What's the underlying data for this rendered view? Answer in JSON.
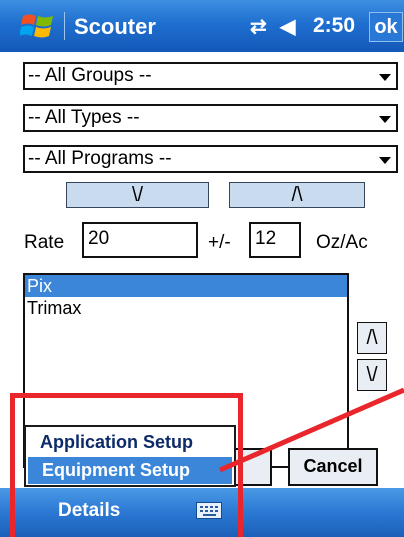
{
  "titlebar": {
    "app_title": "Scouter",
    "time": "2:50",
    "ok_label": "ok",
    "connectivity_icon": "connectivity-icon",
    "volume_icon": "volume-icon",
    "start_icon": "windows-flag-icon"
  },
  "filters": {
    "groups": "-- All Groups --",
    "types": "-- All Types --",
    "programs": "-- All Programs --"
  },
  "sort": {
    "down_label": "\\/",
    "up_label": "/\\"
  },
  "rate": {
    "label": "Rate",
    "value": "20",
    "plusminus_label": "+/-",
    "tolerance": "12",
    "unit": "Oz/Ac"
  },
  "list": {
    "items": [
      "Pix",
      "Trimax"
    ],
    "selected_index": 0
  },
  "side_buttons": {
    "up": "/\\",
    "down": "\\/"
  },
  "buttons": {
    "cancel": "Cancel"
  },
  "menu": {
    "details": "Details",
    "keyboard_icon": "keyboard-icon",
    "popup": [
      "Application Setup",
      "Equipment Setup"
    ],
    "popup_selected_index": 1
  },
  "colors": {
    "titlebar": "#1f6fd0",
    "selection": "#3b86d9",
    "highlight": "#e8262b"
  }
}
